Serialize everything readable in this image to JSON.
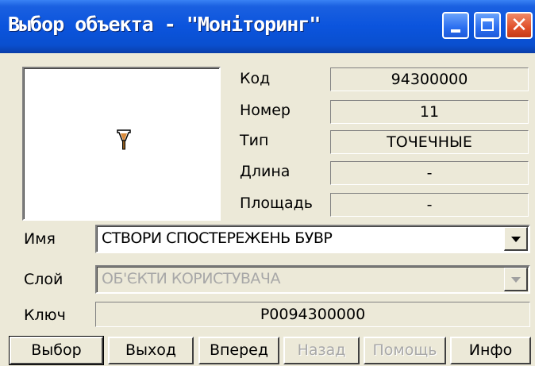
{
  "window": {
    "title": "Выбор объекта - \"Моніторинг\""
  },
  "info": {
    "code_label": "Код",
    "code_value": "94300000",
    "number_label": "Номер",
    "number_value": "11",
    "type_label": "Тип",
    "type_value": "ТОЧЕЧНЫЕ",
    "length_label": "Длина",
    "length_value": "-",
    "area_label": "Площадь",
    "area_value": "-"
  },
  "name": {
    "label": "Имя",
    "value": "СТВОРИ СПОСТЕРЕЖЕНЬ БУВР"
  },
  "layer": {
    "label": "Слой",
    "value": "ОБ'ЄКТИ КОРИСТУВАЧА"
  },
  "key": {
    "label": "Ключ",
    "value": "P0094300000"
  },
  "buttons": {
    "select": "Выбор",
    "exit": "Выход",
    "forward": "Вперед",
    "back": "Назад",
    "help": "Помощь",
    "info": "Инфо"
  },
  "colors": {
    "titlebar": "#0b54dd",
    "dialog": "#ece9d8",
    "marker": "#8b5a1e"
  },
  "icons": {
    "preview_marker": "point-marker-icon"
  }
}
